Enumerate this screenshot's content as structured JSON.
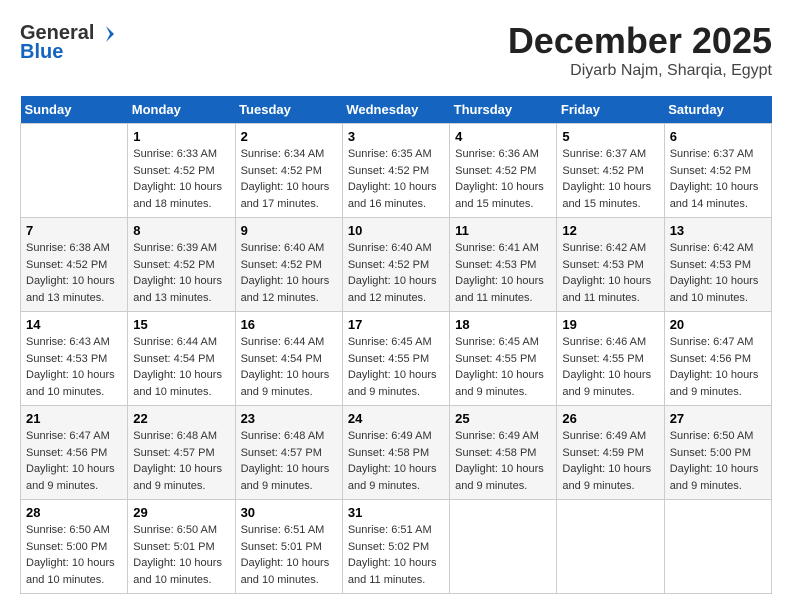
{
  "header": {
    "logo_line1": "General",
    "logo_line2": "Blue",
    "month_title": "December 2025",
    "location": "Diyarb Najm, Sharqia, Egypt"
  },
  "days_of_week": [
    "Sunday",
    "Monday",
    "Tuesday",
    "Wednesday",
    "Thursday",
    "Friday",
    "Saturday"
  ],
  "weeks": [
    [
      {
        "num": "",
        "info": ""
      },
      {
        "num": "1",
        "info": "Sunrise: 6:33 AM\nSunset: 4:52 PM\nDaylight: 10 hours\nand 18 minutes."
      },
      {
        "num": "2",
        "info": "Sunrise: 6:34 AM\nSunset: 4:52 PM\nDaylight: 10 hours\nand 17 minutes."
      },
      {
        "num": "3",
        "info": "Sunrise: 6:35 AM\nSunset: 4:52 PM\nDaylight: 10 hours\nand 16 minutes."
      },
      {
        "num": "4",
        "info": "Sunrise: 6:36 AM\nSunset: 4:52 PM\nDaylight: 10 hours\nand 15 minutes."
      },
      {
        "num": "5",
        "info": "Sunrise: 6:37 AM\nSunset: 4:52 PM\nDaylight: 10 hours\nand 15 minutes."
      },
      {
        "num": "6",
        "info": "Sunrise: 6:37 AM\nSunset: 4:52 PM\nDaylight: 10 hours\nand 14 minutes."
      }
    ],
    [
      {
        "num": "7",
        "info": "Sunrise: 6:38 AM\nSunset: 4:52 PM\nDaylight: 10 hours\nand 13 minutes."
      },
      {
        "num": "8",
        "info": "Sunrise: 6:39 AM\nSunset: 4:52 PM\nDaylight: 10 hours\nand 13 minutes."
      },
      {
        "num": "9",
        "info": "Sunrise: 6:40 AM\nSunset: 4:52 PM\nDaylight: 10 hours\nand 12 minutes."
      },
      {
        "num": "10",
        "info": "Sunrise: 6:40 AM\nSunset: 4:52 PM\nDaylight: 10 hours\nand 12 minutes."
      },
      {
        "num": "11",
        "info": "Sunrise: 6:41 AM\nSunset: 4:53 PM\nDaylight: 10 hours\nand 11 minutes."
      },
      {
        "num": "12",
        "info": "Sunrise: 6:42 AM\nSunset: 4:53 PM\nDaylight: 10 hours\nand 11 minutes."
      },
      {
        "num": "13",
        "info": "Sunrise: 6:42 AM\nSunset: 4:53 PM\nDaylight: 10 hours\nand 10 minutes."
      }
    ],
    [
      {
        "num": "14",
        "info": "Sunrise: 6:43 AM\nSunset: 4:53 PM\nDaylight: 10 hours\nand 10 minutes."
      },
      {
        "num": "15",
        "info": "Sunrise: 6:44 AM\nSunset: 4:54 PM\nDaylight: 10 hours\nand 10 minutes."
      },
      {
        "num": "16",
        "info": "Sunrise: 6:44 AM\nSunset: 4:54 PM\nDaylight: 10 hours\nand 9 minutes."
      },
      {
        "num": "17",
        "info": "Sunrise: 6:45 AM\nSunset: 4:55 PM\nDaylight: 10 hours\nand 9 minutes."
      },
      {
        "num": "18",
        "info": "Sunrise: 6:45 AM\nSunset: 4:55 PM\nDaylight: 10 hours\nand 9 minutes."
      },
      {
        "num": "19",
        "info": "Sunrise: 6:46 AM\nSunset: 4:55 PM\nDaylight: 10 hours\nand 9 minutes."
      },
      {
        "num": "20",
        "info": "Sunrise: 6:47 AM\nSunset: 4:56 PM\nDaylight: 10 hours\nand 9 minutes."
      }
    ],
    [
      {
        "num": "21",
        "info": "Sunrise: 6:47 AM\nSunset: 4:56 PM\nDaylight: 10 hours\nand 9 minutes."
      },
      {
        "num": "22",
        "info": "Sunrise: 6:48 AM\nSunset: 4:57 PM\nDaylight: 10 hours\nand 9 minutes."
      },
      {
        "num": "23",
        "info": "Sunrise: 6:48 AM\nSunset: 4:57 PM\nDaylight: 10 hours\nand 9 minutes."
      },
      {
        "num": "24",
        "info": "Sunrise: 6:49 AM\nSunset: 4:58 PM\nDaylight: 10 hours\nand 9 minutes."
      },
      {
        "num": "25",
        "info": "Sunrise: 6:49 AM\nSunset: 4:58 PM\nDaylight: 10 hours\nand 9 minutes."
      },
      {
        "num": "26",
        "info": "Sunrise: 6:49 AM\nSunset: 4:59 PM\nDaylight: 10 hours\nand 9 minutes."
      },
      {
        "num": "27",
        "info": "Sunrise: 6:50 AM\nSunset: 5:00 PM\nDaylight: 10 hours\nand 9 minutes."
      }
    ],
    [
      {
        "num": "28",
        "info": "Sunrise: 6:50 AM\nSunset: 5:00 PM\nDaylight: 10 hours\nand 10 minutes."
      },
      {
        "num": "29",
        "info": "Sunrise: 6:50 AM\nSunset: 5:01 PM\nDaylight: 10 hours\nand 10 minutes."
      },
      {
        "num": "30",
        "info": "Sunrise: 6:51 AM\nSunset: 5:01 PM\nDaylight: 10 hours\nand 10 minutes."
      },
      {
        "num": "31",
        "info": "Sunrise: 6:51 AM\nSunset: 5:02 PM\nDaylight: 10 hours\nand 11 minutes."
      },
      {
        "num": "",
        "info": ""
      },
      {
        "num": "",
        "info": ""
      },
      {
        "num": "",
        "info": ""
      }
    ]
  ]
}
